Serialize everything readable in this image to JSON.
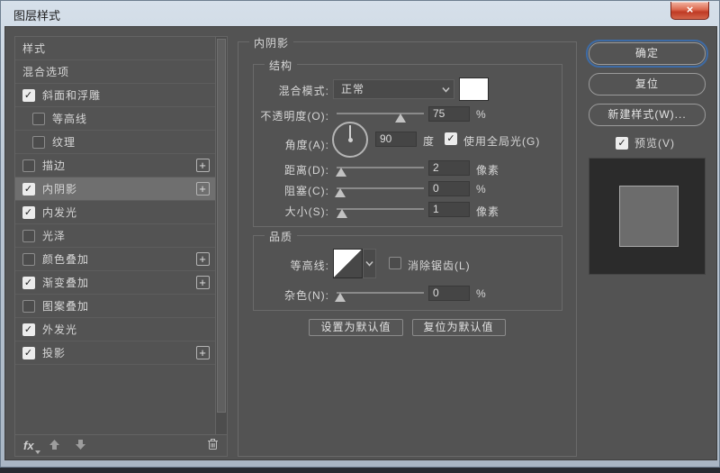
{
  "glyphs": {
    "check": "✓",
    "plus": "+",
    "close": "×"
  },
  "colors": {
    "dialog_bg": "#535353",
    "selected_row": "#6f6f6f",
    "accent_focus_blue": "#3d6ba6",
    "close_red": "#bf3a24",
    "swatch_white": "#ffffff"
  },
  "window": {
    "title": "图层样式"
  },
  "sidebar": {
    "items": [
      {
        "key": "styles",
        "label": "样式",
        "has_checkbox": false,
        "checked": false,
        "indent": false,
        "plus": false,
        "selected": false
      },
      {
        "key": "blending-options",
        "label": "混合选项",
        "has_checkbox": false,
        "checked": false,
        "indent": false,
        "plus": false,
        "selected": false
      },
      {
        "key": "bevel-emboss",
        "label": "斜面和浮雕",
        "has_checkbox": true,
        "checked": true,
        "indent": false,
        "plus": false,
        "selected": false
      },
      {
        "key": "contour",
        "label": "等高线",
        "has_checkbox": true,
        "checked": false,
        "indent": true,
        "plus": false,
        "selected": false
      },
      {
        "key": "texture",
        "label": "纹理",
        "has_checkbox": true,
        "checked": false,
        "indent": true,
        "plus": false,
        "selected": false
      },
      {
        "key": "stroke",
        "label": "描边",
        "has_checkbox": true,
        "checked": false,
        "indent": false,
        "plus": true,
        "selected": false
      },
      {
        "key": "inner-shadow",
        "label": "内阴影",
        "has_checkbox": true,
        "checked": true,
        "indent": false,
        "plus": true,
        "selected": true
      },
      {
        "key": "inner-glow",
        "label": "内发光",
        "has_checkbox": true,
        "checked": true,
        "indent": false,
        "plus": false,
        "selected": false
      },
      {
        "key": "satin",
        "label": "光泽",
        "has_checkbox": true,
        "checked": false,
        "indent": false,
        "plus": false,
        "selected": false
      },
      {
        "key": "color-overlay",
        "label": "颜色叠加",
        "has_checkbox": true,
        "checked": false,
        "indent": false,
        "plus": true,
        "selected": false
      },
      {
        "key": "gradient-overlay",
        "label": "渐变叠加",
        "has_checkbox": true,
        "checked": true,
        "indent": false,
        "plus": true,
        "selected": false
      },
      {
        "key": "pattern-overlay",
        "label": "图案叠加",
        "has_checkbox": true,
        "checked": false,
        "indent": false,
        "plus": false,
        "selected": false
      },
      {
        "key": "outer-glow",
        "label": "外发光",
        "has_checkbox": true,
        "checked": true,
        "indent": false,
        "plus": false,
        "selected": false
      },
      {
        "key": "drop-shadow",
        "label": "投影",
        "has_checkbox": true,
        "checked": true,
        "indent": false,
        "plus": true,
        "selected": false
      }
    ]
  },
  "panel": {
    "title": "内阴影",
    "structure": {
      "title": "结构",
      "blend_mode_label": "混合模式:",
      "blend_mode_value": "正常",
      "opacity_label": "不透明度(O):",
      "opacity_value": "75",
      "opacity_unit": "%",
      "angle_label": "角度(A):",
      "angle_value": "90",
      "angle_unit": "度",
      "global_light_label": "使用全局光(G)",
      "global_light_checked": true,
      "distance_label": "距离(D):",
      "distance_value": "2",
      "distance_unit": "像素",
      "choke_label": "阻塞(C):",
      "choke_value": "0",
      "choke_unit": "%",
      "size_label": "大小(S):",
      "size_value": "1",
      "size_unit": "像素"
    },
    "quality": {
      "title": "品质",
      "contour_label": "等高线:",
      "antialias_label": "消除锯齿(L)",
      "antialias_checked": false,
      "noise_label": "杂色(N):",
      "noise_value": "0",
      "noise_unit": "%"
    },
    "footer_buttons": {
      "make_default": "设置为默认值",
      "reset_default": "复位为默认值"
    }
  },
  "actions": {
    "ok": "确定",
    "reset": "复位",
    "new_style": "新建样式(W)...",
    "preview_label": "预览(V)",
    "preview_checked": true
  }
}
